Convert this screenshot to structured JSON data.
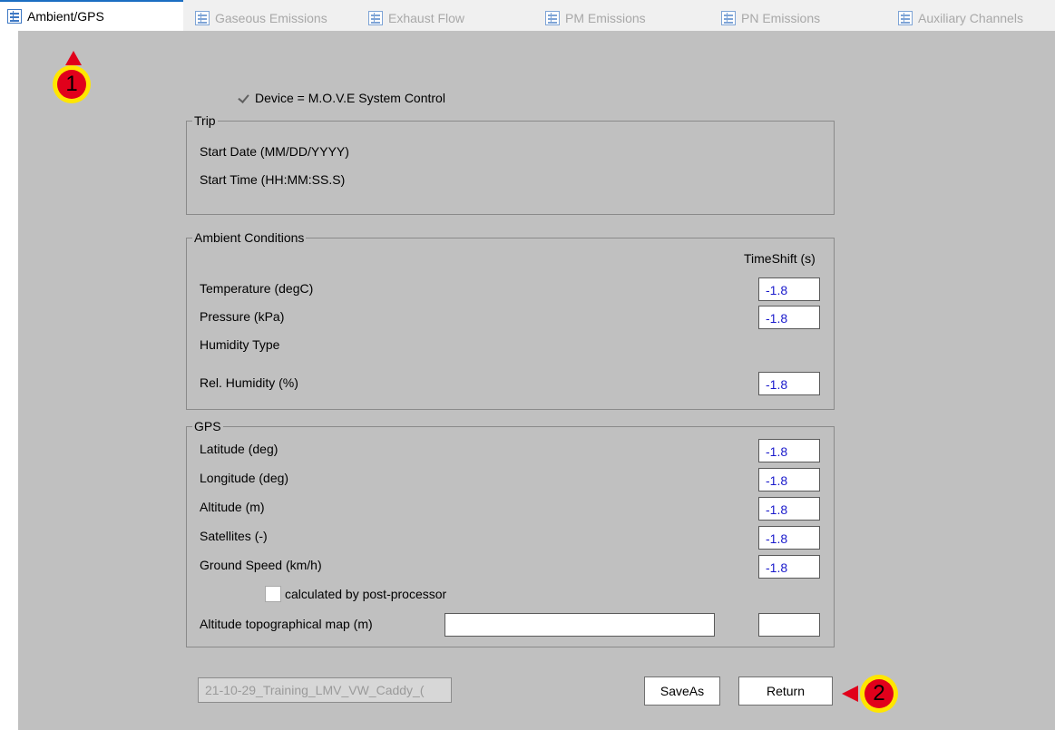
{
  "tabs": [
    {
      "label": "Ambient/GPS",
      "icon": "table-icon",
      "active": true
    },
    {
      "label": "Gaseous Emissions",
      "icon": "table-icon",
      "active": false
    },
    {
      "label": "Exhaust Flow",
      "icon": "table-icon",
      "active": false
    },
    {
      "label": "PM Emissions",
      "icon": "table-icon",
      "active": false
    },
    {
      "label": "PN Emissions",
      "icon": "table-icon",
      "active": false
    },
    {
      "label": "Auxiliary Channels",
      "icon": "table-icon",
      "active": false
    }
  ],
  "device": {
    "label": "Device = M.O.V.E System Control",
    "checked": true
  },
  "trip": {
    "legend": "Trip",
    "start_date_label": "Start Date (MM/DD/YYYY)",
    "start_time_label": "Start Time (HH:MM:SS.S)"
  },
  "ambient": {
    "legend": "Ambient Conditions",
    "timeshift_header": "TimeShift (s)",
    "temperature": {
      "label": "Temperature (degC)",
      "value": "-1.8"
    },
    "pressure": {
      "label": "Pressure (kPa)",
      "value": "-1.8"
    },
    "humidity_type": {
      "label": "Humidity Type"
    },
    "rel_humidity": {
      "label": "Rel. Humidity (%)",
      "value": "-1.8"
    }
  },
  "gps": {
    "legend": "GPS",
    "latitude": {
      "label": "Latitude (deg)",
      "value": "-1.8"
    },
    "longitude": {
      "label": "Longitude (deg)",
      "value": "-1.8"
    },
    "altitude": {
      "label": "Altitude (m)",
      "value": "-1.8"
    },
    "satellites": {
      "label": "Satellites (-)",
      "value": "-1.8"
    },
    "ground_speed": {
      "label": "Ground Speed (km/h)",
      "value": "-1.8"
    },
    "calculated_label": "calculated by post-processor",
    "calculated_checked": false,
    "topo_label": "Altitude topographical map (m)",
    "topo_value": "",
    "topo_timeshift": ""
  },
  "footer": {
    "file_name": "21-10-29_Training_LMV_VW_Caddy_(",
    "saveas_label": "SaveAs",
    "return_label": "Return"
  },
  "annotations": [
    {
      "number": "1",
      "color": "#e1001b",
      "ring": "#ffe600"
    },
    {
      "number": "2",
      "color": "#e1001b",
      "ring": "#ffe600"
    }
  ]
}
